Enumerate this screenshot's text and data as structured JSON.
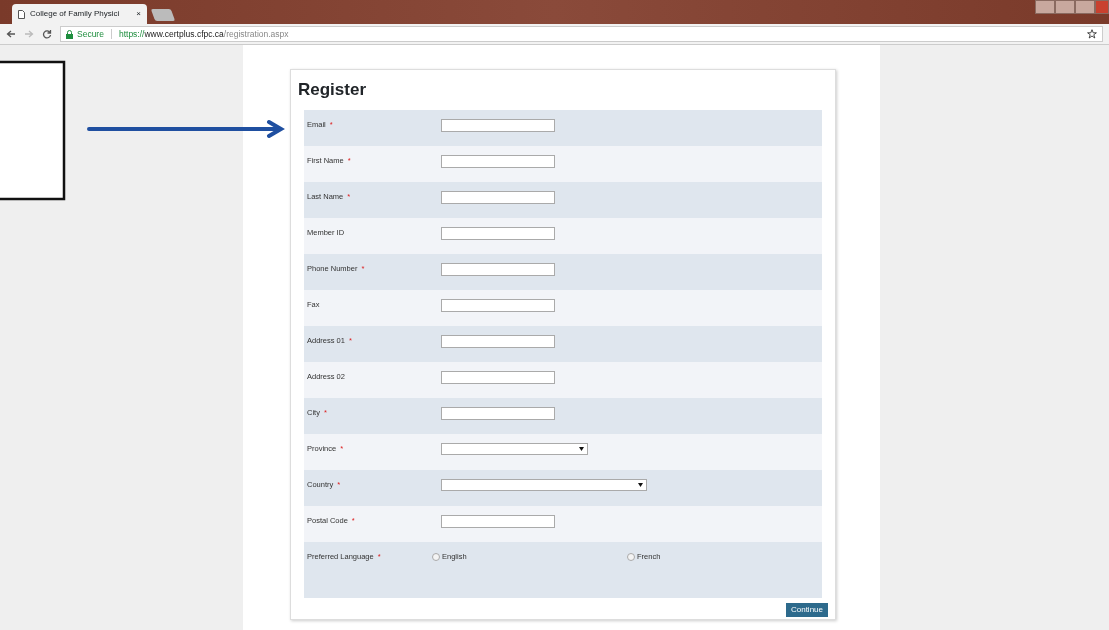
{
  "browser": {
    "tab": {
      "title": "College of Family Physici",
      "close": "×"
    },
    "security": "Secure",
    "url": {
      "scheme": "https://",
      "host": "www.certplus.cfpc.ca",
      "path": "/registration.aspx"
    }
  },
  "form": {
    "title": "Register",
    "fields": [
      {
        "kind": "text",
        "label": "Email",
        "required_mark": "*"
      },
      {
        "kind": "text",
        "label": "First Name",
        "required_mark": "*"
      },
      {
        "kind": "text",
        "label": "Last Name",
        "required_mark": "*"
      },
      {
        "kind": "text",
        "label": "Member ID"
      },
      {
        "kind": "text",
        "label": "Phone Number",
        "required_mark": "*"
      },
      {
        "kind": "text",
        "label": "Fax"
      },
      {
        "kind": "text",
        "label": "Address 01",
        "required_mark": "*"
      },
      {
        "kind": "text",
        "label": "Address 02"
      },
      {
        "kind": "text",
        "label": "City",
        "required_mark": "*"
      },
      {
        "kind": "select",
        "label": "Province",
        "required_mark": "*"
      },
      {
        "kind": "select",
        "label": "Country",
        "required_mark": "*"
      },
      {
        "kind": "text",
        "label": "Postal Code",
        "required_mark": "*"
      },
      {
        "kind": "radio",
        "label": "Preferred Language",
        "required_mark": "*",
        "options": [
          {
            "label": "English",
            "selected": false
          },
          {
            "label": "French",
            "selected": false
          }
        ]
      }
    ],
    "submit": "Continue"
  }
}
